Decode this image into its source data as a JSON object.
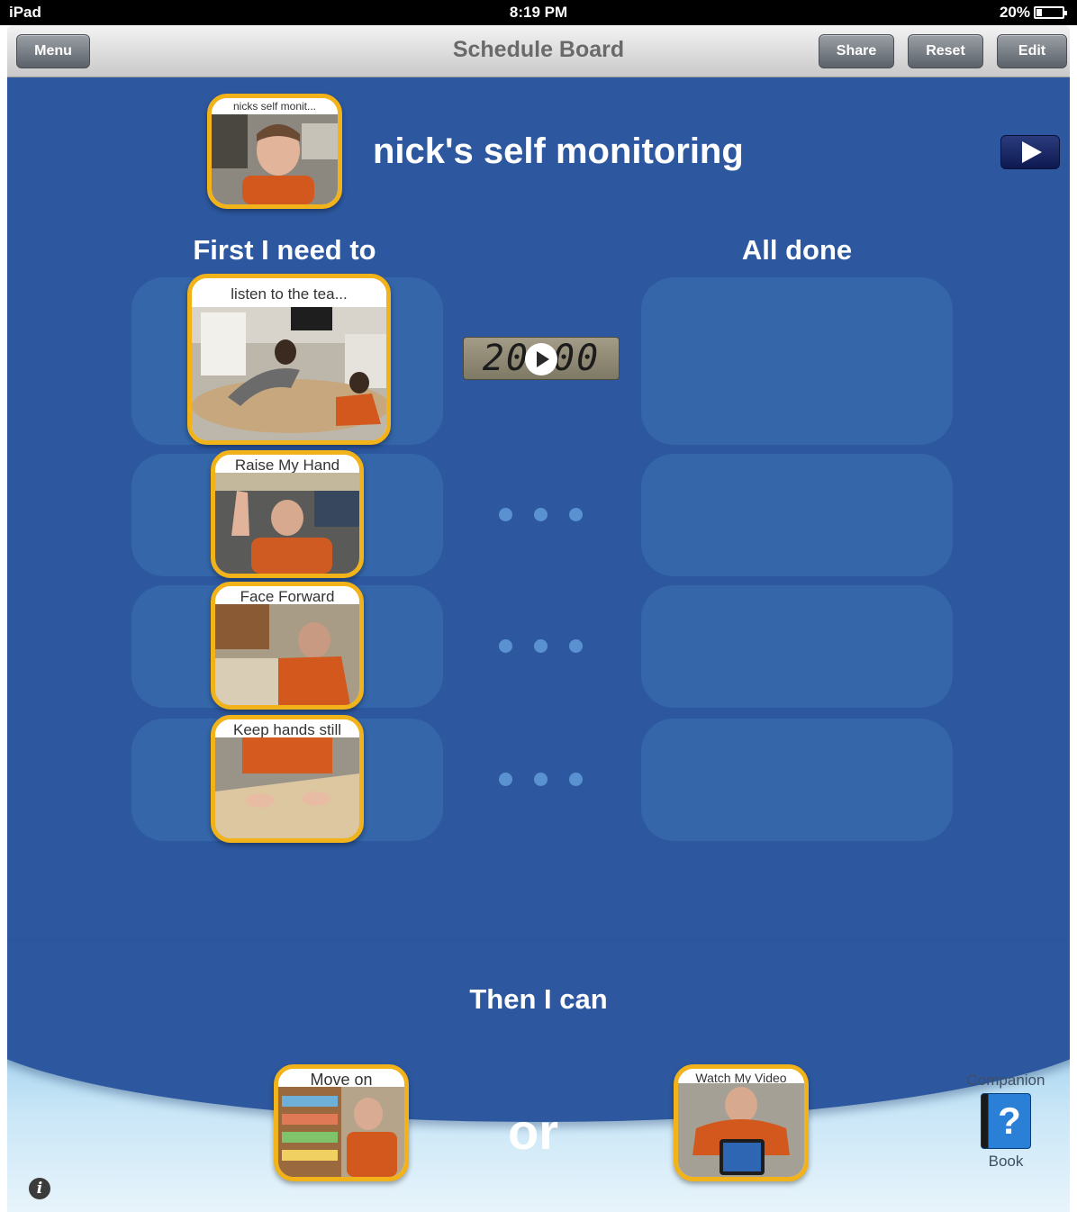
{
  "status_bar": {
    "device": "iPad",
    "time": "8:19 PM",
    "battery": "20%",
    "battery_level": 0.2
  },
  "nav": {
    "title": "Schedule Board",
    "menu_label": "Menu",
    "share_label": "Share",
    "reset_label": "Reset",
    "edit_label": "Edit"
  },
  "schedule": {
    "thumb_caption": "nicks self monit...",
    "title": "nick's self monitoring",
    "play_icon": "play-icon"
  },
  "columns": {
    "first": "First I need to",
    "done": "All done"
  },
  "timer": {
    "display": "20:00",
    "icon": "play-icon"
  },
  "tasks": [
    {
      "label": "listen to the tea..."
    },
    {
      "label": "Raise My Hand"
    },
    {
      "label": "Face Forward"
    },
    {
      "label": "Keep hands still"
    }
  ],
  "rewards": {
    "heading": "Then I can",
    "or_label": "or",
    "items": [
      {
        "label": "Move on"
      },
      {
        "label": "Watch My Video"
      }
    ]
  },
  "companion": {
    "top_label": "Companion",
    "bottom_label": "Book",
    "icon": "question-book-icon"
  },
  "info_icon": "info-icon",
  "colors": {
    "board": "#2d58a0",
    "slot": "#3466a9",
    "card_border": "#f2b21a",
    "dots": "#5a91d0"
  }
}
